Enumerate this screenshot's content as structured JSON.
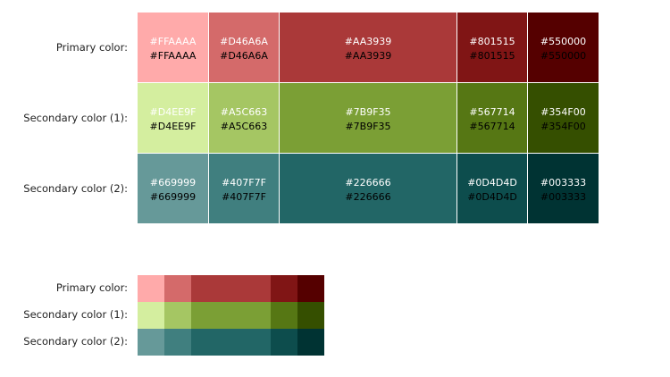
{
  "palette": {
    "rows": [
      {
        "label": "Primary color:",
        "swatches": [
          {
            "hex": "#FFAAAA",
            "color": "#FFAAAA",
            "light_text": "#FFFFFF",
            "dark_text": "#000000"
          },
          {
            "hex": "#D46A6A",
            "color": "#D46A6A",
            "light_text": "#FFFFFF",
            "dark_text": "#000000"
          },
          {
            "hex": "#AA3939",
            "color": "#AA3939",
            "light_text": "#FFFFFF",
            "dark_text": "#000000"
          },
          {
            "hex": "#801515",
            "color": "#801515",
            "light_text": "#FFFFFF",
            "dark_text": "#000000"
          },
          {
            "hex": "#550000",
            "color": "#550000",
            "light_text": "#FFFFFF",
            "dark_text": "#000000"
          }
        ]
      },
      {
        "label": "Secondary color (1):",
        "swatches": [
          {
            "hex": "#D4EE9F",
            "color": "#D4EE9F",
            "light_text": "#FFFFFF",
            "dark_text": "#000000"
          },
          {
            "hex": "#A5C663",
            "color": "#A5C663",
            "light_text": "#FFFFFF",
            "dark_text": "#000000"
          },
          {
            "hex": "#7B9F35",
            "color": "#7B9F35",
            "light_text": "#FFFFFF",
            "dark_text": "#000000"
          },
          {
            "hex": "#567714",
            "color": "#567714",
            "light_text": "#FFFFFF",
            "dark_text": "#000000"
          },
          {
            "hex": "#354F00",
            "color": "#354F00",
            "light_text": "#FFFFFF",
            "dark_text": "#000000"
          }
        ]
      },
      {
        "label": "Secondary color (2):",
        "swatches": [
          {
            "hex": "#669999",
            "color": "#669999",
            "light_text": "#FFFFFF",
            "dark_text": "#000000"
          },
          {
            "hex": "#407F7F",
            "color": "#407F7F",
            "light_text": "#FFFFFF",
            "dark_text": "#000000"
          },
          {
            "hex": "#226666",
            "color": "#226666",
            "light_text": "#FFFFFF",
            "dark_text": "#000000"
          },
          {
            "hex": "#0D4D4D",
            "color": "#0D4D4D",
            "light_text": "#FFFFFF",
            "dark_text": "#000000"
          },
          {
            "hex": "#003333",
            "color": "#003333",
            "light_text": "#FFFFFF",
            "dark_text": "#000000"
          }
        ]
      }
    ]
  },
  "strips": {
    "rows": [
      {
        "label": "Primary color:",
        "colors": [
          "#FFAAAA",
          "#D46A6A",
          "#AA3939",
          "#801515",
          "#550000"
        ]
      },
      {
        "label": "Secondary color (1):",
        "colors": [
          "#D4EE9F",
          "#A5C663",
          "#7B9F35",
          "#567714",
          "#354F00"
        ]
      },
      {
        "label": "Secondary color (2):",
        "colors": [
          "#669999",
          "#407F7F",
          "#226666",
          "#0D4D4D",
          "#003333"
        ]
      }
    ]
  }
}
